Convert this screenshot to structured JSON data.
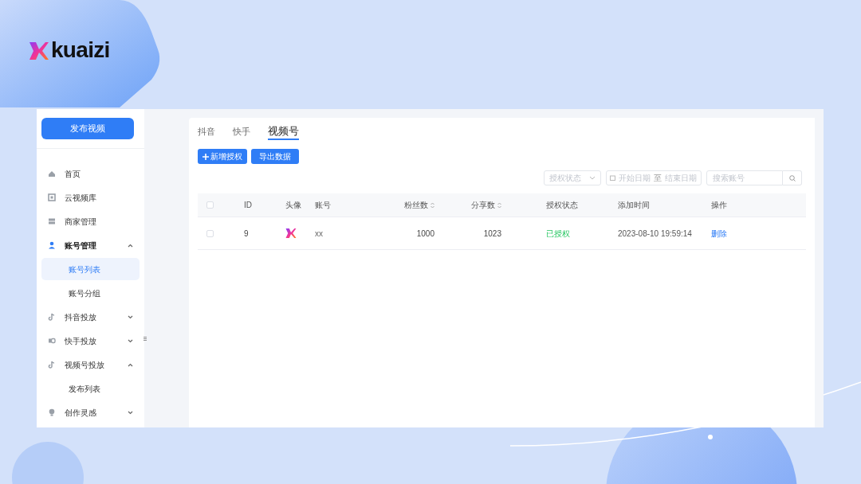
{
  "logo": {
    "text": "kuaizi"
  },
  "sidebar": {
    "publish_button": "发布视频",
    "items": [
      {
        "kind": "link",
        "label": "首页"
      },
      {
        "kind": "link",
        "label": "云视频库"
      },
      {
        "kind": "link",
        "label": "商家管理"
      },
      {
        "kind": "group",
        "label": "账号管理",
        "expanded": true,
        "children": [
          {
            "label": "账号列表",
            "selected": true
          },
          {
            "label": "账号分组",
            "selected": false
          }
        ]
      },
      {
        "kind": "group",
        "label": "抖音投放",
        "expanded": false
      },
      {
        "kind": "group",
        "label": "快手投放",
        "expanded": false
      },
      {
        "kind": "group",
        "label": "视频号投放",
        "expanded": true,
        "children": [
          {
            "label": "发布列表",
            "selected": false
          }
        ]
      },
      {
        "kind": "group",
        "label": "创作灵感",
        "expanded": false
      }
    ]
  },
  "tabs": [
    {
      "label": "抖音",
      "selected": false
    },
    {
      "label": "快手",
      "selected": false
    },
    {
      "label": "视频号",
      "selected": true
    }
  ],
  "toolbar": {
    "add_button": "新增授权",
    "export_button": "导出数据"
  },
  "filters": {
    "status_select": {
      "placeholder": "授权状态"
    },
    "date_range": {
      "start_placeholder": "开始日期",
      "separator": "至",
      "end_placeholder": "结束日期"
    },
    "search": {
      "placeholder": "搜索账号"
    }
  },
  "table": {
    "select_all_checked": false,
    "columns": [
      {
        "label": "ID",
        "sortable": false
      },
      {
        "label": "头像",
        "sortable": false
      },
      {
        "label": "账号",
        "sortable": false
      },
      {
        "label": "粉丝数",
        "sortable": true
      },
      {
        "label": "分享数",
        "sortable": true
      },
      {
        "label": "授权状态",
        "sortable": false
      },
      {
        "label": "添加时间",
        "sortable": false
      },
      {
        "label": "操作",
        "sortable": false
      }
    ],
    "rows": [
      {
        "checked": false,
        "id": "9",
        "account": "xx",
        "fans": "1000",
        "shares": "1023",
        "status": "已授权",
        "authorized": true,
        "added": "2023-08-10 19:59:14",
        "action": "删除"
      }
    ]
  }
}
